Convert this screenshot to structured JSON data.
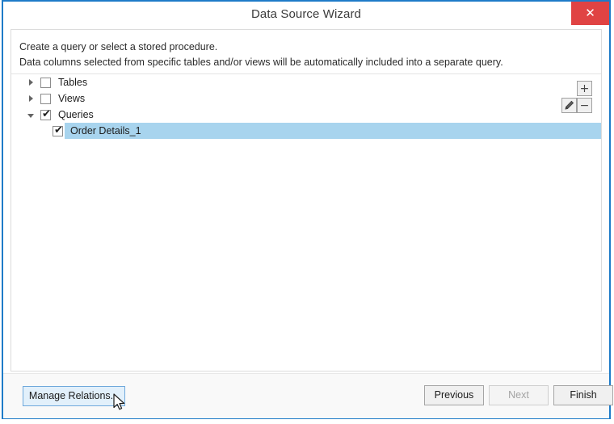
{
  "window": {
    "title": "Data Source Wizard",
    "close_label": "✕",
    "border_color": "#1e7bc8",
    "close_color": "#e04343"
  },
  "description": {
    "line1": "Create a query or select a stored procedure.",
    "line2": "Data columns selected from specific tables and/or views will be automatically included into a separate query."
  },
  "tree": {
    "items": [
      {
        "label": "Tables",
        "checked": false,
        "expanded": false,
        "indent": 0,
        "selected": false
      },
      {
        "label": "Views",
        "checked": false,
        "expanded": false,
        "indent": 0,
        "selected": false
      },
      {
        "label": "Queries",
        "checked": true,
        "expanded": true,
        "indent": 0,
        "selected": false
      },
      {
        "label": "Order Details_1",
        "checked": true,
        "expanded": null,
        "indent": 1,
        "selected": true
      }
    ],
    "selection_color": "#a8d4ee",
    "check_glyph": "✔"
  },
  "side_actions": {
    "add_label": "+",
    "edit_label": "edit",
    "remove_label": "−"
  },
  "footer": {
    "manage_relations_label": "Manage Relations...",
    "previous_label": "Previous",
    "next_label": "Next",
    "finish_label": "Finish",
    "next_enabled": false,
    "manage_hover": true
  }
}
